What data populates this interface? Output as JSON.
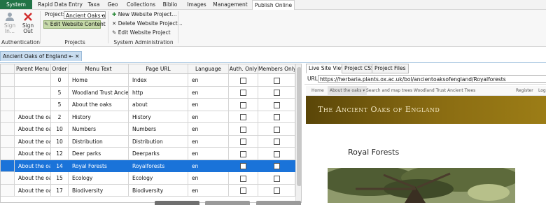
{
  "menu_tabs": [
    "System",
    "Rapid Data Entry",
    "Taxa",
    "Geo",
    "Collections",
    "Biblio",
    "Images",
    "Management",
    "Publish Online"
  ],
  "ribbon": {
    "auth": {
      "sign_in": "Sign In...",
      "sign_out": "Sign Out",
      "group": "Authentication"
    },
    "projects": {
      "project_label": "Project:",
      "project_value": "Ancient Oaks o",
      "edit_content": "Edit Website Content",
      "group": "Projects"
    },
    "sysadmin": {
      "new_project": "New Website Project...",
      "delete_project": "Delete Website Project...",
      "edit_project": "Edit Website Project",
      "group": "System Administration"
    }
  },
  "doc_tab": {
    "title": "Ancient Oaks of England",
    "pin": "⇤",
    "close": "✕"
  },
  "grid": {
    "columns": [
      "Parent Menu",
      "Order",
      "Menu Text",
      "Page URL",
      "Language",
      "Auth. Only",
      "Members Only"
    ],
    "rows": [
      {
        "parent": "",
        "order": "0",
        "text": "Home",
        "url": "Index",
        "lang": "en",
        "selected": false
      },
      {
        "parent": "",
        "order": "5",
        "text": "Woodland Trust Ancier",
        "url": "http",
        "lang": "en",
        "selected": false
      },
      {
        "parent": "",
        "order": "5",
        "text": "About the oaks",
        "url": "about",
        "lang": "en",
        "selected": false
      },
      {
        "parent": "About the oaks",
        "order": "2",
        "text": "History",
        "url": "History",
        "lang": "en",
        "selected": false
      },
      {
        "parent": "About the oaks",
        "order": "10",
        "text": "Numbers",
        "url": "Numbers",
        "lang": "en",
        "selected": false
      },
      {
        "parent": "About the oaks",
        "order": "10",
        "text": "Distribution",
        "url": "Distribution",
        "lang": "en",
        "selected": false
      },
      {
        "parent": "About the oaks",
        "order": "12",
        "text": "Deer parks",
        "url": "Deerparks",
        "lang": "en",
        "selected": false
      },
      {
        "parent": "About the oaks",
        "order": "14",
        "text": "Royal Forests",
        "url": "Royalforests",
        "lang": "en",
        "selected": true
      },
      {
        "parent": "About the oaks",
        "order": "15",
        "text": "Ecology",
        "url": "Ecology",
        "lang": "en",
        "selected": false
      },
      {
        "parent": "About the oaks",
        "order": "17",
        "text": "Biodiversity",
        "url": "Biodiversity",
        "lang": "en",
        "selected": false
      }
    ]
  },
  "preview": {
    "tabs": [
      "Live Site View",
      "Project CSS",
      "Project Files"
    ],
    "url_label": "URL",
    "url": "https://herbaria.plants.ox.ac.uk/bol/ancientoaksofengland/Royalforests",
    "site_nav": [
      "Home",
      "About the oaks ▾",
      "Search and map trees",
      "Woodland Trust Ancient Trees"
    ],
    "site_nav_right": [
      "Register",
      "Log"
    ],
    "banner_title": "The Ancient Oaks of England",
    "page_heading": "Royal Forests"
  },
  "colors": {
    "accent": "#217346",
    "selection": "#1a73d9",
    "banner": "#8a6c12"
  }
}
